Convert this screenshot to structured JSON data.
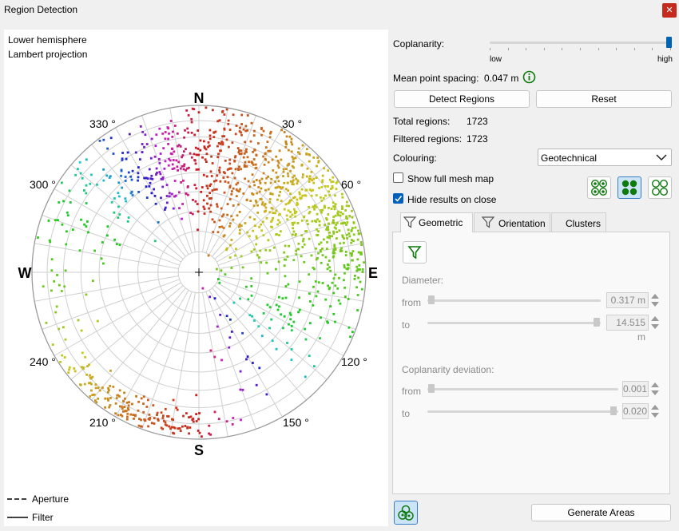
{
  "window": {
    "title": "Region Detection",
    "close_glyph": "✕"
  },
  "plot": {
    "caption_line1": "Lower hemisphere",
    "caption_line2": "Lambert projection",
    "cardinals": {
      "n": "N",
      "e": "E",
      "s": "S",
      "w": "W"
    },
    "angle_labels": [
      "30 °",
      "60 °",
      "120 °",
      "150 °",
      "210 °",
      "240 °",
      "300 °",
      "330 °"
    ],
    "legend": {
      "aperture": "Aperture",
      "filter": "Filter"
    }
  },
  "settings": {
    "coplanarity_label": "Coplanarity:",
    "coplanarity_level": 1.0,
    "slider_low": "low",
    "slider_high": "high",
    "mean_spacing_label": "Mean point spacing:",
    "mean_spacing_value": "0.047 m",
    "info_icon": "info-icon",
    "detect_button": "Detect Regions",
    "reset_button": "Reset",
    "total_regions_label": "Total regions:",
    "total_regions_value": "1723",
    "filtered_regions_label": "Filtered regions:",
    "filtered_regions_value": "1723",
    "colouring_label": "Colouring:",
    "colouring_value": "Geotechnical",
    "show_mesh_label": "Show full mesh map",
    "show_mesh_checked": false,
    "hide_results_label": "Hide results on close",
    "hide_results_checked": true,
    "accent_color": "#0e7a0d"
  },
  "tabs": [
    {
      "label": "Geometric",
      "active": true
    },
    {
      "label": "Orientation",
      "active": false
    },
    {
      "label": "Clusters",
      "active": false
    }
  ],
  "geometric": {
    "diameter_label": "Diameter:",
    "from_label": "from",
    "to_label": "to",
    "diameter_from": "0.317 m",
    "diameter_to": "14.515 m",
    "coplanarity_dev_label": "Coplanarity deviation:",
    "dev_from": "0.001",
    "dev_to": "0.020"
  },
  "footer": {
    "generate_button": "Generate Areas"
  }
}
